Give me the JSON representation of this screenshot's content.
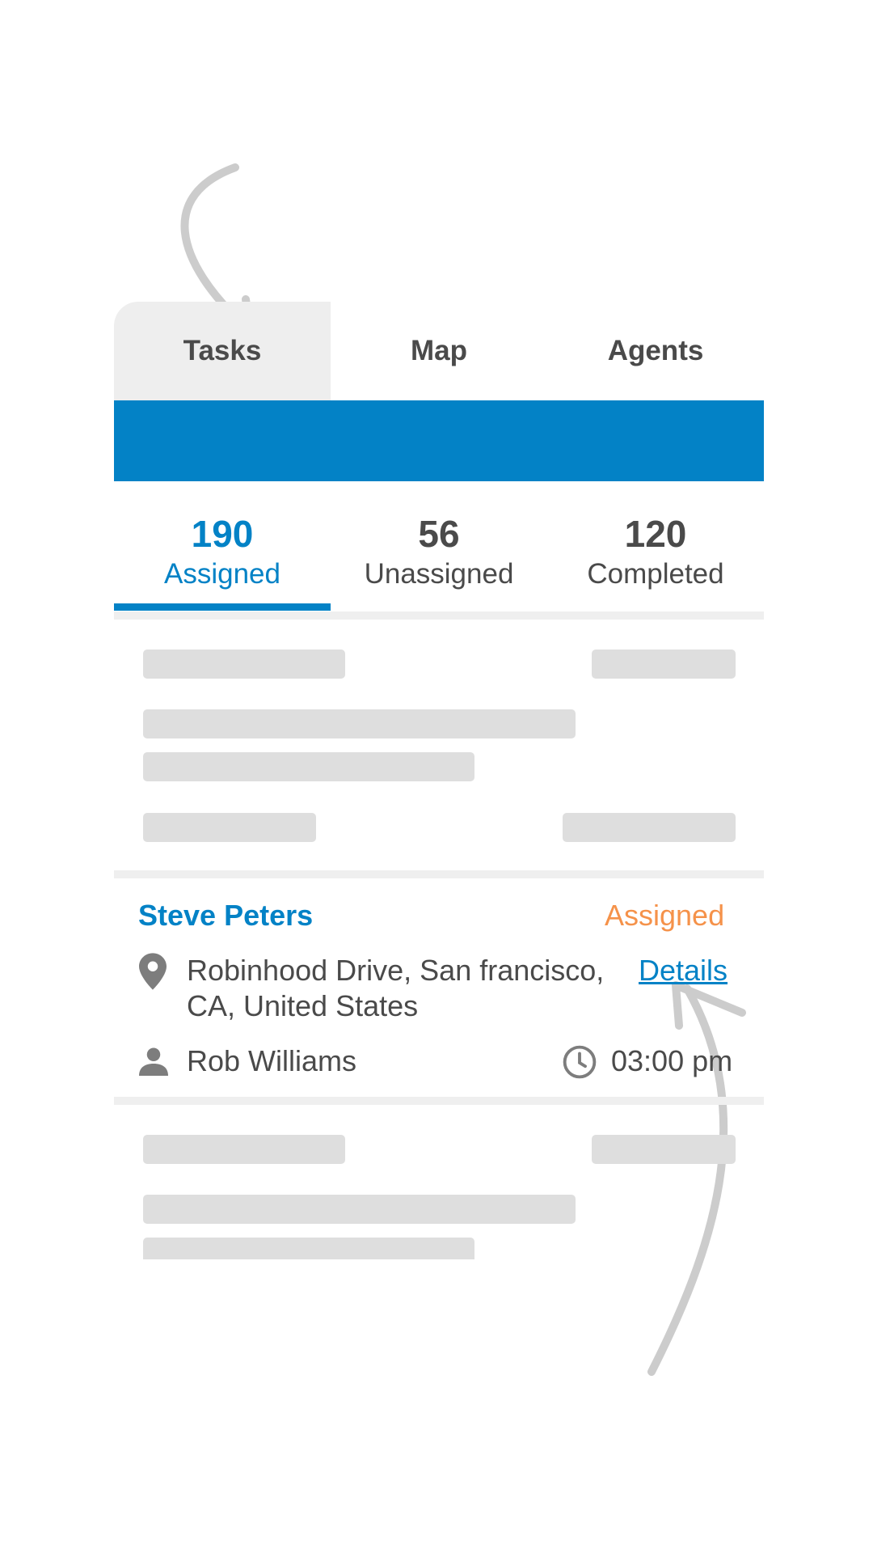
{
  "top_tabs": [
    {
      "label": "Tasks",
      "active": true
    },
    {
      "label": "Map",
      "active": false
    },
    {
      "label": "Agents",
      "active": false
    }
  ],
  "stats": [
    {
      "count": "190",
      "label": "Assigned",
      "active": true
    },
    {
      "count": "56",
      "label": "Unassigned",
      "active": false
    },
    {
      "count": "120",
      "label": "Completed",
      "active": false
    }
  ],
  "task": {
    "customer": "Steve Peters",
    "status": "Assigned",
    "address_line1": "Robinhood Drive, San francisco,",
    "address_line2": "CA, United States",
    "details_label": "Details",
    "agent": "Rob Williams",
    "time": "03:00 pm"
  },
  "colors": {
    "primary": "#0382c6",
    "status_assigned": "#f5924a",
    "text": "#4a4a4a",
    "skeleton": "#dedede",
    "active_tab_bg": "#eeeeee"
  },
  "icons": {
    "location": "location-pin-icon",
    "person": "person-icon",
    "clock": "clock-icon"
  }
}
